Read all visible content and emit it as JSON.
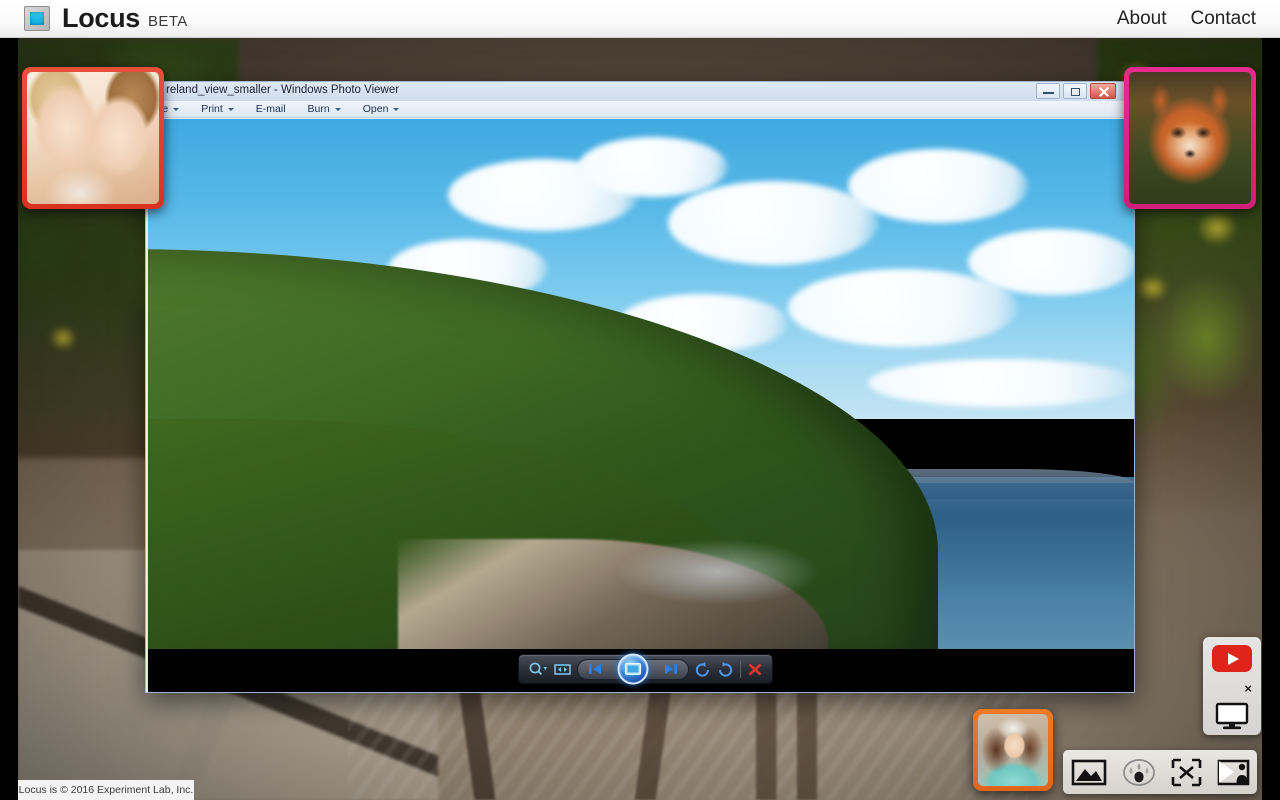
{
  "header": {
    "logo_icon": "screen-logo-icon",
    "brand": "Locus",
    "badge": "BETA",
    "nav": [
      {
        "label": "About",
        "name": "about"
      },
      {
        "label": "Contact",
        "name": "contact"
      }
    ]
  },
  "photo_viewer": {
    "title": "reland_view_smaller - Windows Photo Viewer",
    "window_buttons": [
      {
        "name": "minimize",
        "icon": "minimize-icon"
      },
      {
        "name": "maximize",
        "icon": "maximize-icon"
      },
      {
        "name": "close",
        "icon": "close-icon"
      }
    ],
    "menu": [
      {
        "label": "le",
        "has_caret": true,
        "name": "file"
      },
      {
        "label": "Print",
        "has_caret": true,
        "name": "print"
      },
      {
        "label": "E-mail",
        "has_caret": false,
        "name": "email"
      },
      {
        "label": "Burn",
        "has_caret": true,
        "name": "burn"
      },
      {
        "label": "Open",
        "has_caret": true,
        "name": "open"
      }
    ],
    "controls": [
      {
        "name": "zoom",
        "icon": "magnifier-dropdown-icon"
      },
      {
        "name": "fit-to-window",
        "icon": "fit-to-window-icon"
      },
      {
        "name": "previous",
        "icon": "previous-icon"
      },
      {
        "name": "play-slideshow",
        "icon": "slideshow-play-icon"
      },
      {
        "name": "next",
        "icon": "next-icon"
      },
      {
        "name": "rotate-counterclockwise",
        "icon": "rotate-ccw-icon"
      },
      {
        "name": "rotate-clockwise",
        "icon": "rotate-cw-icon"
      },
      {
        "name": "delete",
        "icon": "delete-red-x-icon"
      }
    ],
    "image_subject": "Ireland coastal view - green hills, blue sea, clouds"
  },
  "thumbnails": [
    {
      "name": "thumbnail-girls",
      "subject": "Two women whispering",
      "border_color": "#e8503c"
    },
    {
      "name": "thumbnail-fox",
      "subject": "Red fox portrait",
      "border_color": "#e82a8e"
    },
    {
      "name": "thumbnail-woman",
      "subject": "Woman with headband",
      "border_color": "#f07a22"
    }
  ],
  "widget_panel": {
    "youtube_button": "youtube-play-icon",
    "close_label": "×",
    "monitor_icon": "monitor-icon"
  },
  "icon_bar": [
    {
      "name": "image-icon",
      "label": "image"
    },
    {
      "name": "gaze-heatmap-icon",
      "label": "gaze"
    },
    {
      "name": "fullscreen-icon",
      "label": "fullscreen"
    },
    {
      "name": "present-icon",
      "label": "present"
    }
  ],
  "footer": {
    "copyright": "Locus is © 2016 Experiment Lab, Inc."
  }
}
